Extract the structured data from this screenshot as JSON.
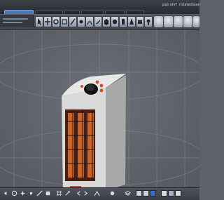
{
  "menubar": {
    "right_labels": [
      "pan",
      "shrf",
      "rotated",
      "was"
    ],
    "tabs": [
      {
        "name": "scene",
        "active": true
      },
      {
        "name": "tab-2",
        "active": false
      },
      {
        "name": "tab-3",
        "active": false
      },
      {
        "name": "tab-4",
        "active": false
      },
      {
        "name": "tab-5",
        "active": false
      },
      {
        "name": "tab-6",
        "active": false
      }
    ]
  },
  "toolbar": {
    "tools": [
      "select",
      "move",
      "rotate",
      "scale",
      "sculpt",
      "paint",
      "bend",
      "knife",
      "cube",
      "sphere",
      "cylinder",
      "cone",
      "camera",
      "light",
      "gear",
      "grid"
    ],
    "view_buttons": [
      "view-front",
      "view-back",
      "view-left",
      "view-right",
      "view-top",
      "view-persp"
    ]
  },
  "viewport": {
    "object": "space-heater",
    "colors": {
      "body": "#d9d9d9",
      "grill": "#6b2c16",
      "element": "#c9642c",
      "knob": "#1c1c1c",
      "button": "#d24b2e"
    }
  },
  "bottombar": {
    "icons": [
      "undo",
      "lasso",
      "spark",
      "vertex",
      "edge",
      "face",
      "grid",
      "snap",
      "move-left",
      "move-right",
      "frame",
      "render",
      "layers"
    ],
    "swatches": [
      "#c9d1e0",
      "#c9d1e0",
      "#2f6fc7",
      "#d9d9d9",
      "#a7b0bf",
      "#d9d9d9"
    ]
  }
}
